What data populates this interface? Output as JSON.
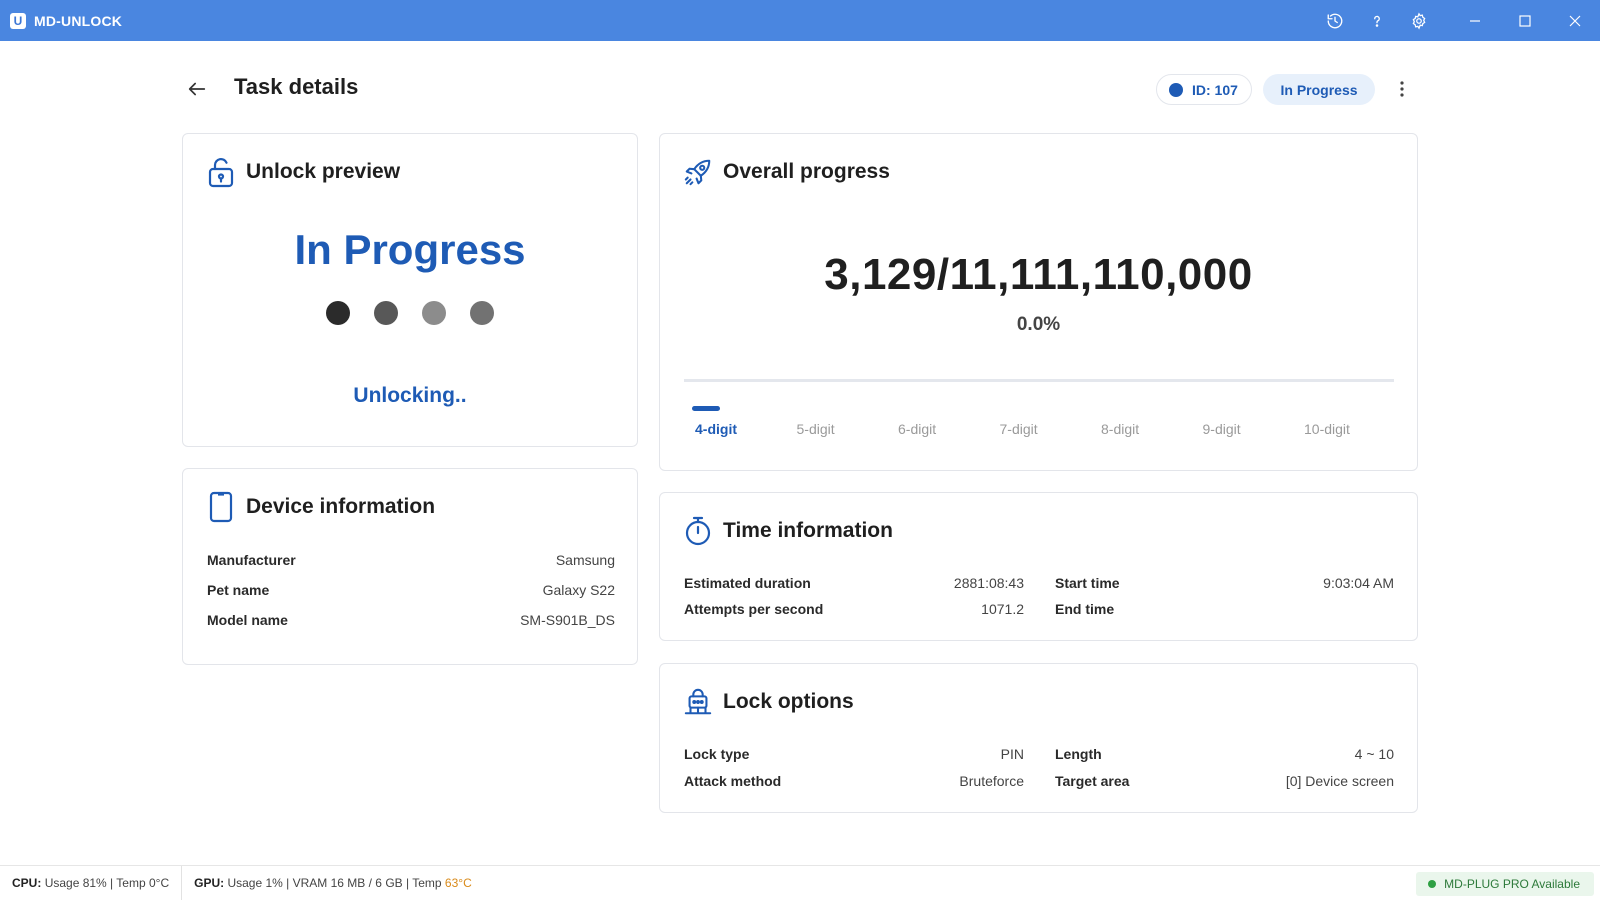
{
  "window": {
    "title": "MD-UNLOCK",
    "logo_letter": "U"
  },
  "header": {
    "title": "Task details",
    "task_id": "ID: 107",
    "status": "In Progress"
  },
  "unlock_preview": {
    "title": "Unlock preview",
    "status": "In Progress",
    "subtitle": "Unlocking..",
    "pin_dot_colors": [
      "#2b2b2b",
      "#585858",
      "#8c8c8c",
      "#727272"
    ]
  },
  "device_info": {
    "title": "Device information",
    "rows": [
      {
        "key": "Manufacturer",
        "value": "Samsung"
      },
      {
        "key": "Pet name",
        "value": "Galaxy S22"
      },
      {
        "key": "Model name",
        "value": "SM-S901B_DS"
      }
    ]
  },
  "overall_progress": {
    "title": "Overall progress",
    "count": "3,129/11,111,110,000",
    "percent": "0.0%",
    "fraction": 0.0,
    "digit_tabs": [
      "4-digit",
      "5-digit",
      "6-digit",
      "7-digit",
      "8-digit",
      "9-digit",
      "10-digit"
    ],
    "active_tab": 0
  },
  "time_info": {
    "title": "Time information",
    "rows": [
      {
        "key": "Estimated duration",
        "value": "2881:08:43"
      },
      {
        "key": "Attempts per second",
        "value": "1071.2"
      },
      {
        "key": "Start time",
        "value": "9:03:04 AM"
      },
      {
        "key": "End time",
        "value": ""
      }
    ]
  },
  "lock_options": {
    "title": "Lock options",
    "rows": [
      {
        "key": "Lock type",
        "value": "PIN"
      },
      {
        "key": "Attack method",
        "value": "Bruteforce"
      },
      {
        "key": "Length",
        "value": "4 ~ 10"
      },
      {
        "key": "Target area",
        "value": "[0] Device screen"
      }
    ]
  },
  "status_bar": {
    "cpu_label": "CPU:",
    "cpu_text": "Usage 81% | Temp 0°C",
    "gpu_label": "GPU:",
    "gpu_text": "Usage 1% | VRAM 16 MB / 6 GB | Temp",
    "gpu_temp": "63°C",
    "pro_text": "MD-PLUG PRO Available"
  },
  "colors": {
    "titlebar": "#4a86e0",
    "accent": "#1e5bb5",
    "gpu_temp": "#d98a1a",
    "pro_green": "#2ea043"
  }
}
